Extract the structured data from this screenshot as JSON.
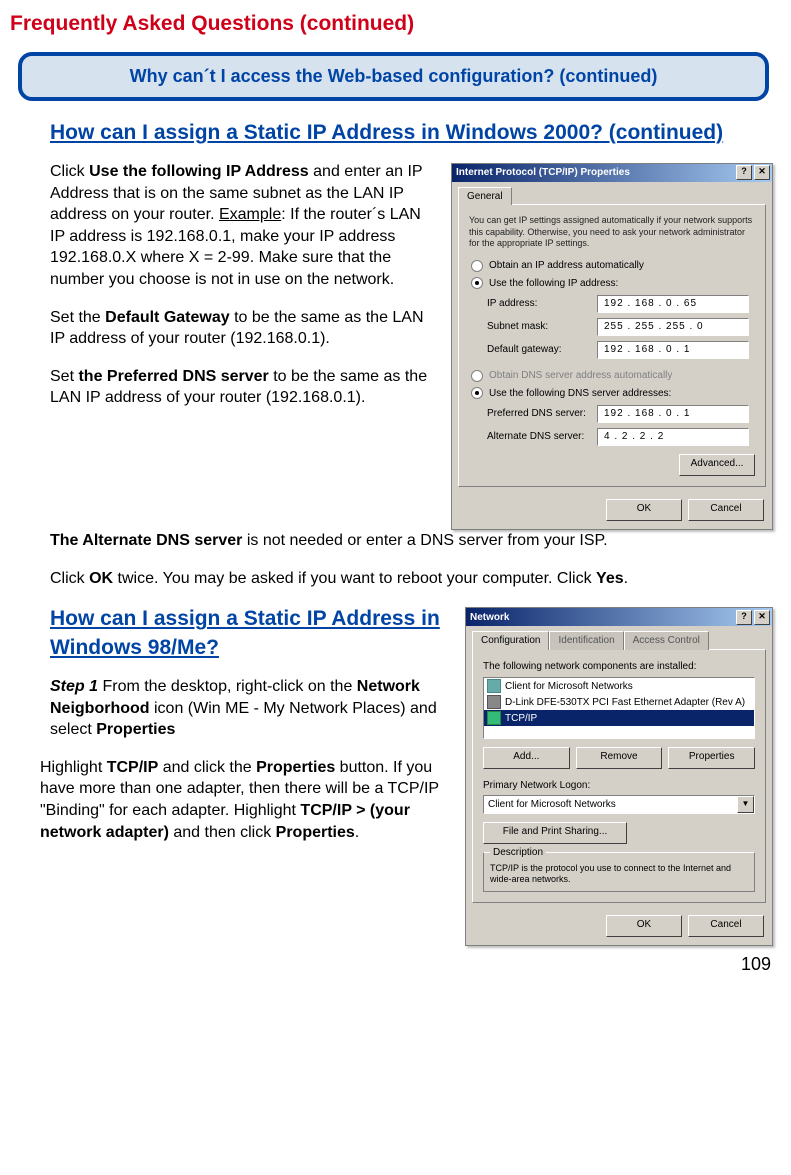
{
  "page_title": "Frequently Asked Questions (continued)",
  "blue_box": "Why can´t I access the Web-based configuration? (continued)",
  "heading1": "How can I assign a Static IP Address in Windows 2000? (continued)",
  "p1_a": "Click ",
  "p1_b": "Use the following IP Address",
  "p1_c": " and enter an IP Address that is on the same subnet as the LAN IP address on your router. ",
  "p1_ex": "Example",
  "p1_d": ": If the router´s LAN IP address is 192.168.0.1, make your IP address 192.168.0.X where X = 2-99. Make sure that the number you choose is not in use on the network.",
  "p2_a": "Set the ",
  "p2_b": "Default Gateway",
  "p2_c": " to be the same as the LAN IP address of your router (192.168.0.1).",
  "p3_a": "Set ",
  "p3_b": "the Preferred DNS server",
  "p3_c": " to be the same as the LAN IP address of your router (192.168.0.1).",
  "p4_a": "The Alternate DNS server",
  "p4_b": " is not needed or enter a DNS server from your ISP.",
  "p5_a": "Click ",
  "p5_b": "OK",
  "p5_c": " twice. You may be asked if you want to reboot your computer. Click ",
  "p5_d": "Yes",
  "p5_e": ".",
  "heading2": "How can I assign a Static IP Address in Windows 98/Me?",
  "p6_step": "Step 1",
  "p6_a": " From the desktop, right-click on the ",
  "p6_b": "Network Neigborhood",
  "p6_c": " icon (Win ME - My Network Places) and select ",
  "p6_d": "Properties",
  "p7_a": "Highlight ",
  "p7_b": "TCP/IP",
  "p7_c": " and click the ",
  "p7_d": "Properties",
  "p7_e": " button. If you have more than one  adapter, then there will be a TCP/IP \"Binding\" for each adapter. Highlight ",
  "p7_f": "TCP/IP > (your network adapter)",
  "p7_g": " and then click ",
  "p7_h": "Properties",
  "p7_i": ".",
  "page_number": "109",
  "dialog1": {
    "title": "Internet Protocol (TCP/IP) Properties",
    "help_btn": "?",
    "close_btn": "✕",
    "tab_general": "General",
    "intro": "You can get IP settings assigned automatically if your network supports this capability. Otherwise, you need to ask your network administrator for the appropriate IP settings.",
    "radio_auto_ip": "Obtain an IP address automatically",
    "radio_use_ip": "Use the following IP address:",
    "lbl_ip": "IP address:",
    "val_ip": "192 . 168 .  0  .  65",
    "lbl_subnet": "Subnet mask:",
    "val_subnet": "255 . 255 . 255 .  0",
    "lbl_gateway": "Default gateway:",
    "val_gateway": "192 . 168 .  0  .  1",
    "radio_auto_dns": "Obtain DNS server address automatically",
    "radio_use_dns": "Use the following DNS server addresses:",
    "lbl_pref_dns": "Preferred DNS server:",
    "val_pref_dns": "192 . 168 .  0  .  1",
    "lbl_alt_dns": "Alternate DNS server:",
    "val_alt_dns": " 4  .  2  .  2  .  2",
    "btn_advanced": "Advanced...",
    "btn_ok": "OK",
    "btn_cancel": "Cancel"
  },
  "dialog2": {
    "title": "Network",
    "help_btn": "?",
    "close_btn": "✕",
    "tab_config": "Configuration",
    "tab_ident": "Identification",
    "tab_access": "Access Control",
    "lbl_components": "The following network components are installed:",
    "item1": "Client for Microsoft Networks",
    "item2": "D-Link DFE-530TX PCI Fast Ethernet Adapter (Rev A)",
    "item3": "TCP/IP",
    "btn_add": "Add...",
    "btn_remove": "Remove",
    "btn_properties": "Properties",
    "lbl_logon": "Primary Network Logon:",
    "logon_value": "Client for Microsoft Networks",
    "btn_file_print": "File and Print Sharing...",
    "group_desc": "Description",
    "desc_text": "TCP/IP is the protocol you use to connect to the Internet and wide-area networks.",
    "btn_ok": "OK",
    "btn_cancel": "Cancel"
  }
}
